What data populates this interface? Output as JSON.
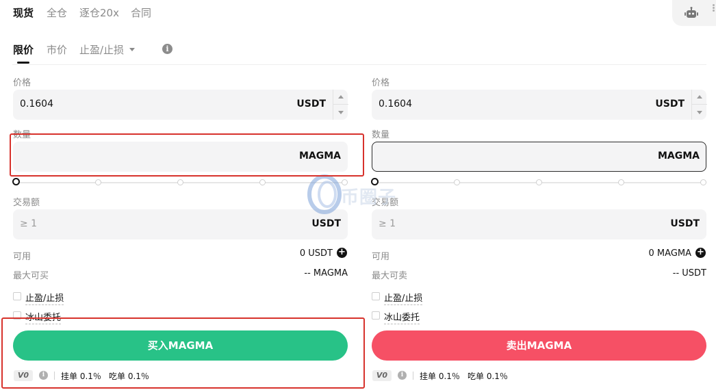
{
  "top_tabs": [
    "现货",
    "全仓",
    "逐仓20x",
    "合同"
  ],
  "order_tabs": [
    "限价",
    "市价",
    "止盈/止损"
  ],
  "buy": {
    "price_label": "价格",
    "price_value": "0.1604",
    "price_unit": "USDT",
    "qty_label": "数量",
    "qty_unit": "MAGMA",
    "amount_label": "交易额",
    "amount_placeholder": "≥ 1",
    "amount_unit": "USDT",
    "available_label": "可用",
    "available_value": "0 USDT",
    "max_label": "最大可买",
    "max_value": "-- MAGMA",
    "tpsl_label": "止盈/止损",
    "iceberg_label": "冰山委托",
    "button_label": "买入MAGMA"
  },
  "sell": {
    "price_label": "价格",
    "price_value": "0.1604",
    "price_unit": "USDT",
    "qty_label": "数量",
    "qty_unit": "MAGMA",
    "amount_label": "交易额",
    "amount_placeholder": "≥ 1",
    "amount_unit": "USDT",
    "available_label": "可用",
    "available_value": "0 MAGMA",
    "max_label": "最大可卖",
    "max_value": "-- USDT",
    "tpsl_label": "止盈/止损",
    "iceberg_label": "冰山委托",
    "button_label": "卖出MAGMA"
  },
  "fees": {
    "vip": "V0",
    "maker_label": "挂单",
    "maker_value": "0.1％",
    "taker_label": "吃单",
    "taker_value": "0.1％"
  },
  "watermark": "币圈子",
  "colors": {
    "buy": "#28c287",
    "sell": "#f65065",
    "highlight": "#d7312b"
  },
  "icons": [
    "robot-icon",
    "info-icon",
    "plus-circle-icon",
    "caret-down-icon"
  ]
}
